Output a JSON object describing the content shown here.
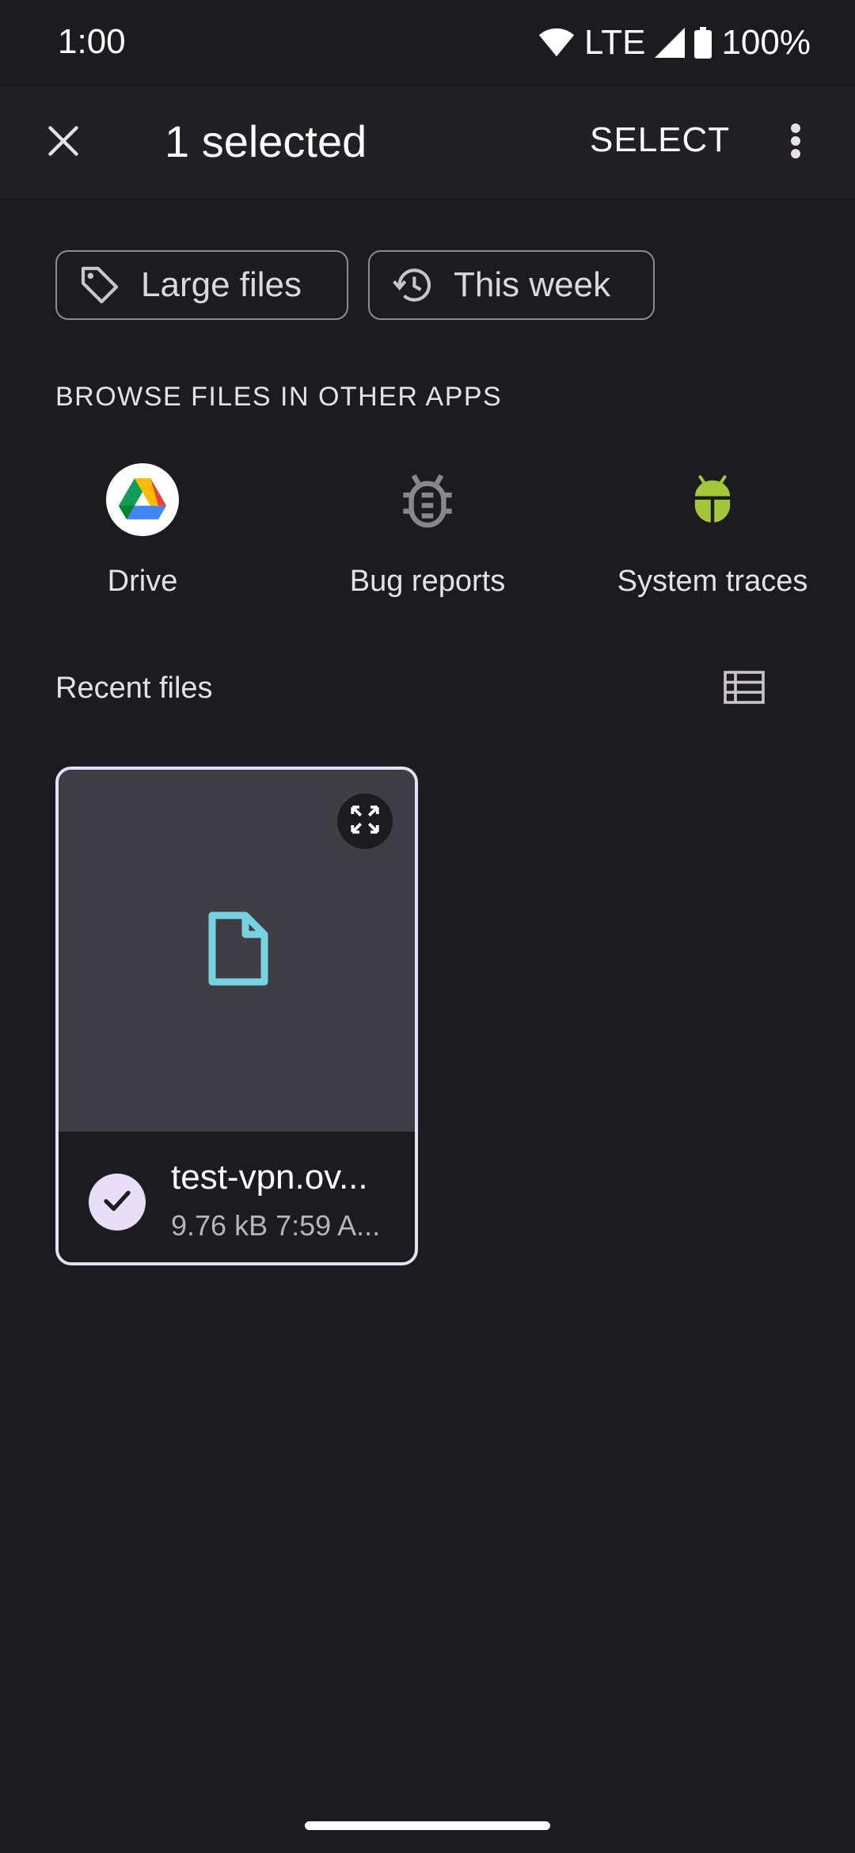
{
  "status_bar": {
    "time": "1:00",
    "network": "LTE",
    "battery": "100%",
    "icons": [
      "wifi-icon",
      "cell-signal-icon",
      "battery-icon"
    ]
  },
  "app_bar": {
    "title": "1 selected",
    "select_label": "SELECT",
    "icons": [
      "close-icon",
      "more-vert-icon"
    ]
  },
  "filters": [
    {
      "label": "Large files",
      "icon": "tag-icon"
    },
    {
      "label": "This week",
      "icon": "history-icon"
    }
  ],
  "browse_section": {
    "heading": "BROWSE FILES IN OTHER APPS",
    "apps": [
      {
        "label": "Drive",
        "icon": "google-drive-icon"
      },
      {
        "label": "Bug reports",
        "icon": "bug-icon"
      },
      {
        "label": "System traces",
        "icon": "android-icon"
      }
    ]
  },
  "recent": {
    "heading": "Recent files",
    "view_toggle_icon": "list-view-icon",
    "files": [
      {
        "name": "test-vpn.ov...",
        "size": "9.76 kB",
        "time": "7:59 A...",
        "meta": "9.76 kB 7:59 A...",
        "selected": true
      }
    ]
  },
  "colors": {
    "background": "#1c1b1f",
    "app_bar": "#212024",
    "card_border": "#e8def8",
    "thumbnail_bg": "#3f3e45",
    "doc_icon": "#78d1e1",
    "android_green": "#a4c639"
  }
}
